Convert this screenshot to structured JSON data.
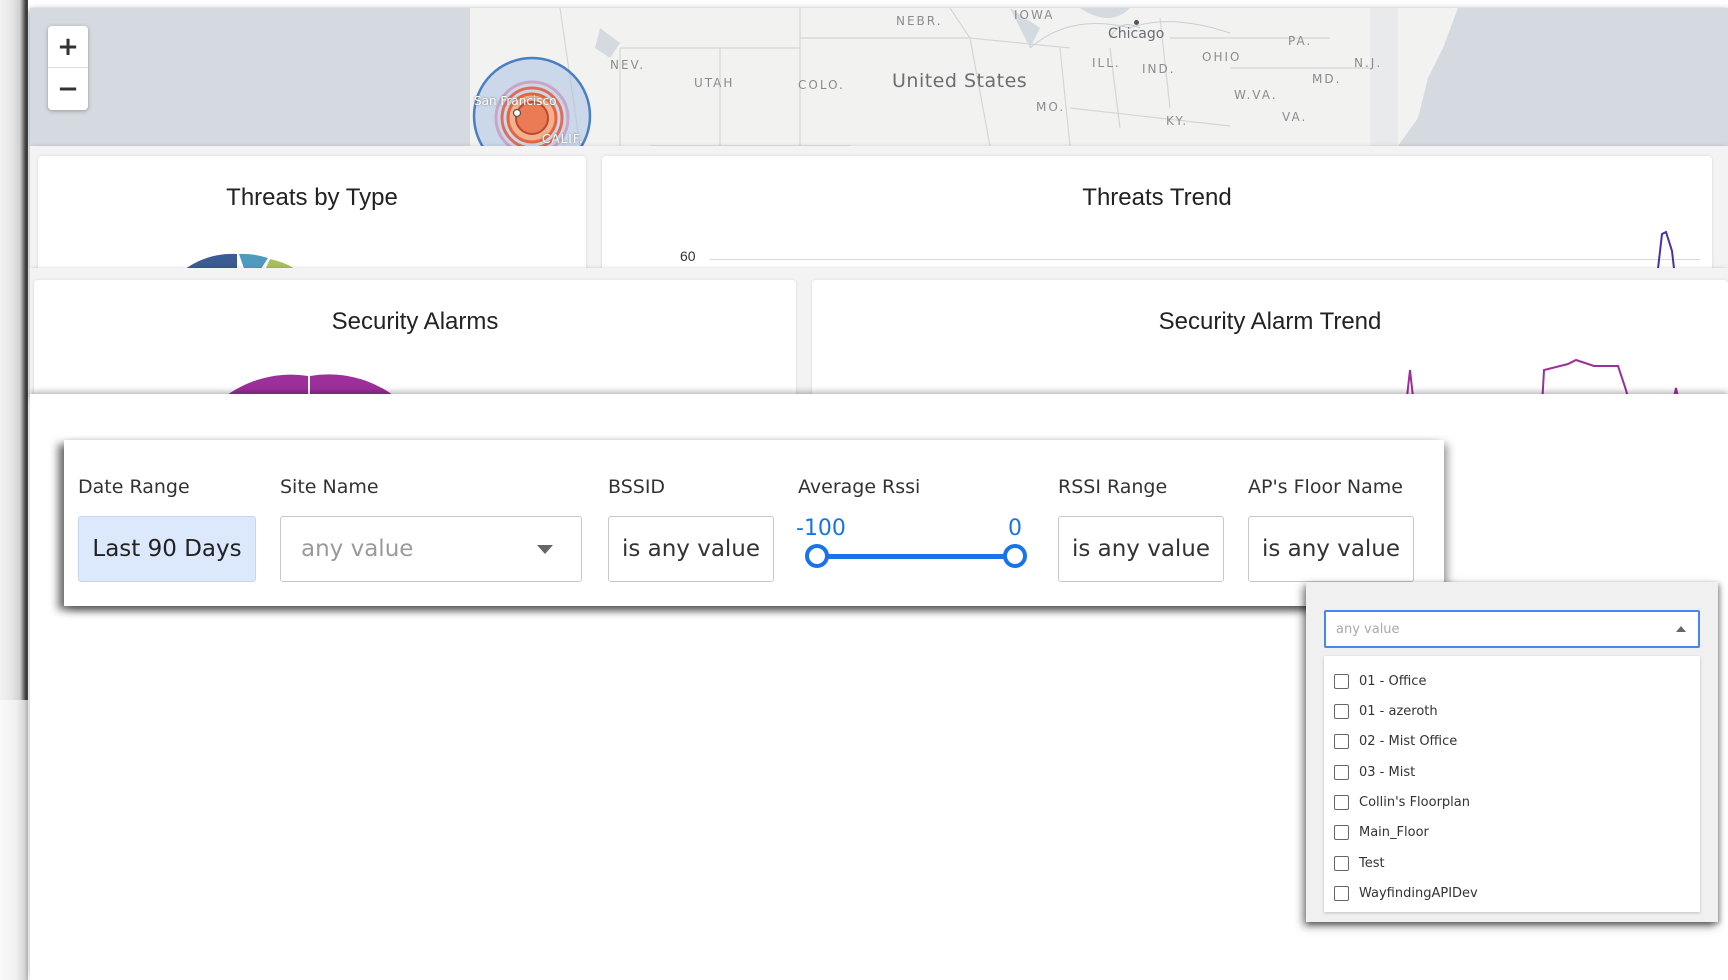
{
  "map": {
    "labels": {
      "nebr": "NEBR.",
      "iowa": "IOWA",
      "chicago": "Chicago",
      "pa": "PA.",
      "nev": "NEV.",
      "ohio": "OHIO",
      "nj": "N.J.",
      "ill": "ILL.",
      "ind": "IND.",
      "utah": "UTAH",
      "colo": "COLO.",
      "united_states": "United States",
      "md": "MD.",
      "wva": "W.VA.",
      "mo": "MO.",
      "ky": "KY.",
      "va": "VA.",
      "san_francisco": "San Francisco",
      "calif": "CALIF."
    },
    "zoom_in_label": "+",
    "zoom_out_label": "−",
    "colors": {
      "cluster_ring": "#4a7fc1",
      "cluster_core": "#e8643a"
    }
  },
  "threats": {
    "by_type_title": "Threats by Type",
    "trend_title": "Threats Trend",
    "trend_axis_tick": "60",
    "colors": {
      "pie_a": "#3b5b92",
      "pie_b": "#4f9bbf",
      "pie_c": "#a9bf5a",
      "line": "#4b2fa8"
    }
  },
  "alarms": {
    "title": "Security Alarms",
    "trend_title": "Security Alarm Trend",
    "colors": {
      "pie": "#9c2f9a",
      "line": "#9c2f9a"
    }
  },
  "filters": {
    "date_range": {
      "label": "Date Range",
      "value": "Last 90 Days"
    },
    "site_name": {
      "label": "Site Name",
      "placeholder": "any value"
    },
    "bssid": {
      "label": "BSSID",
      "value": "is any value"
    },
    "average_rssi": {
      "label": "Average Rssi",
      "min": "-100",
      "max": "0"
    },
    "rssi_range": {
      "label": "RSSI Range",
      "value": "is any value"
    },
    "ap_floor_name": {
      "label": "AP's Floor Name",
      "value": "is any value"
    }
  },
  "floor_dropdown": {
    "placeholder": "any value",
    "options": [
      "01 - Office",
      "01 - azeroth",
      "02 - Mist Office",
      "03 - Mist",
      "Collin's Floorplan",
      "Main_Floor",
      "Test",
      "WayfindingAPIDev"
    ]
  },
  "accent_color": "#1a73e8"
}
